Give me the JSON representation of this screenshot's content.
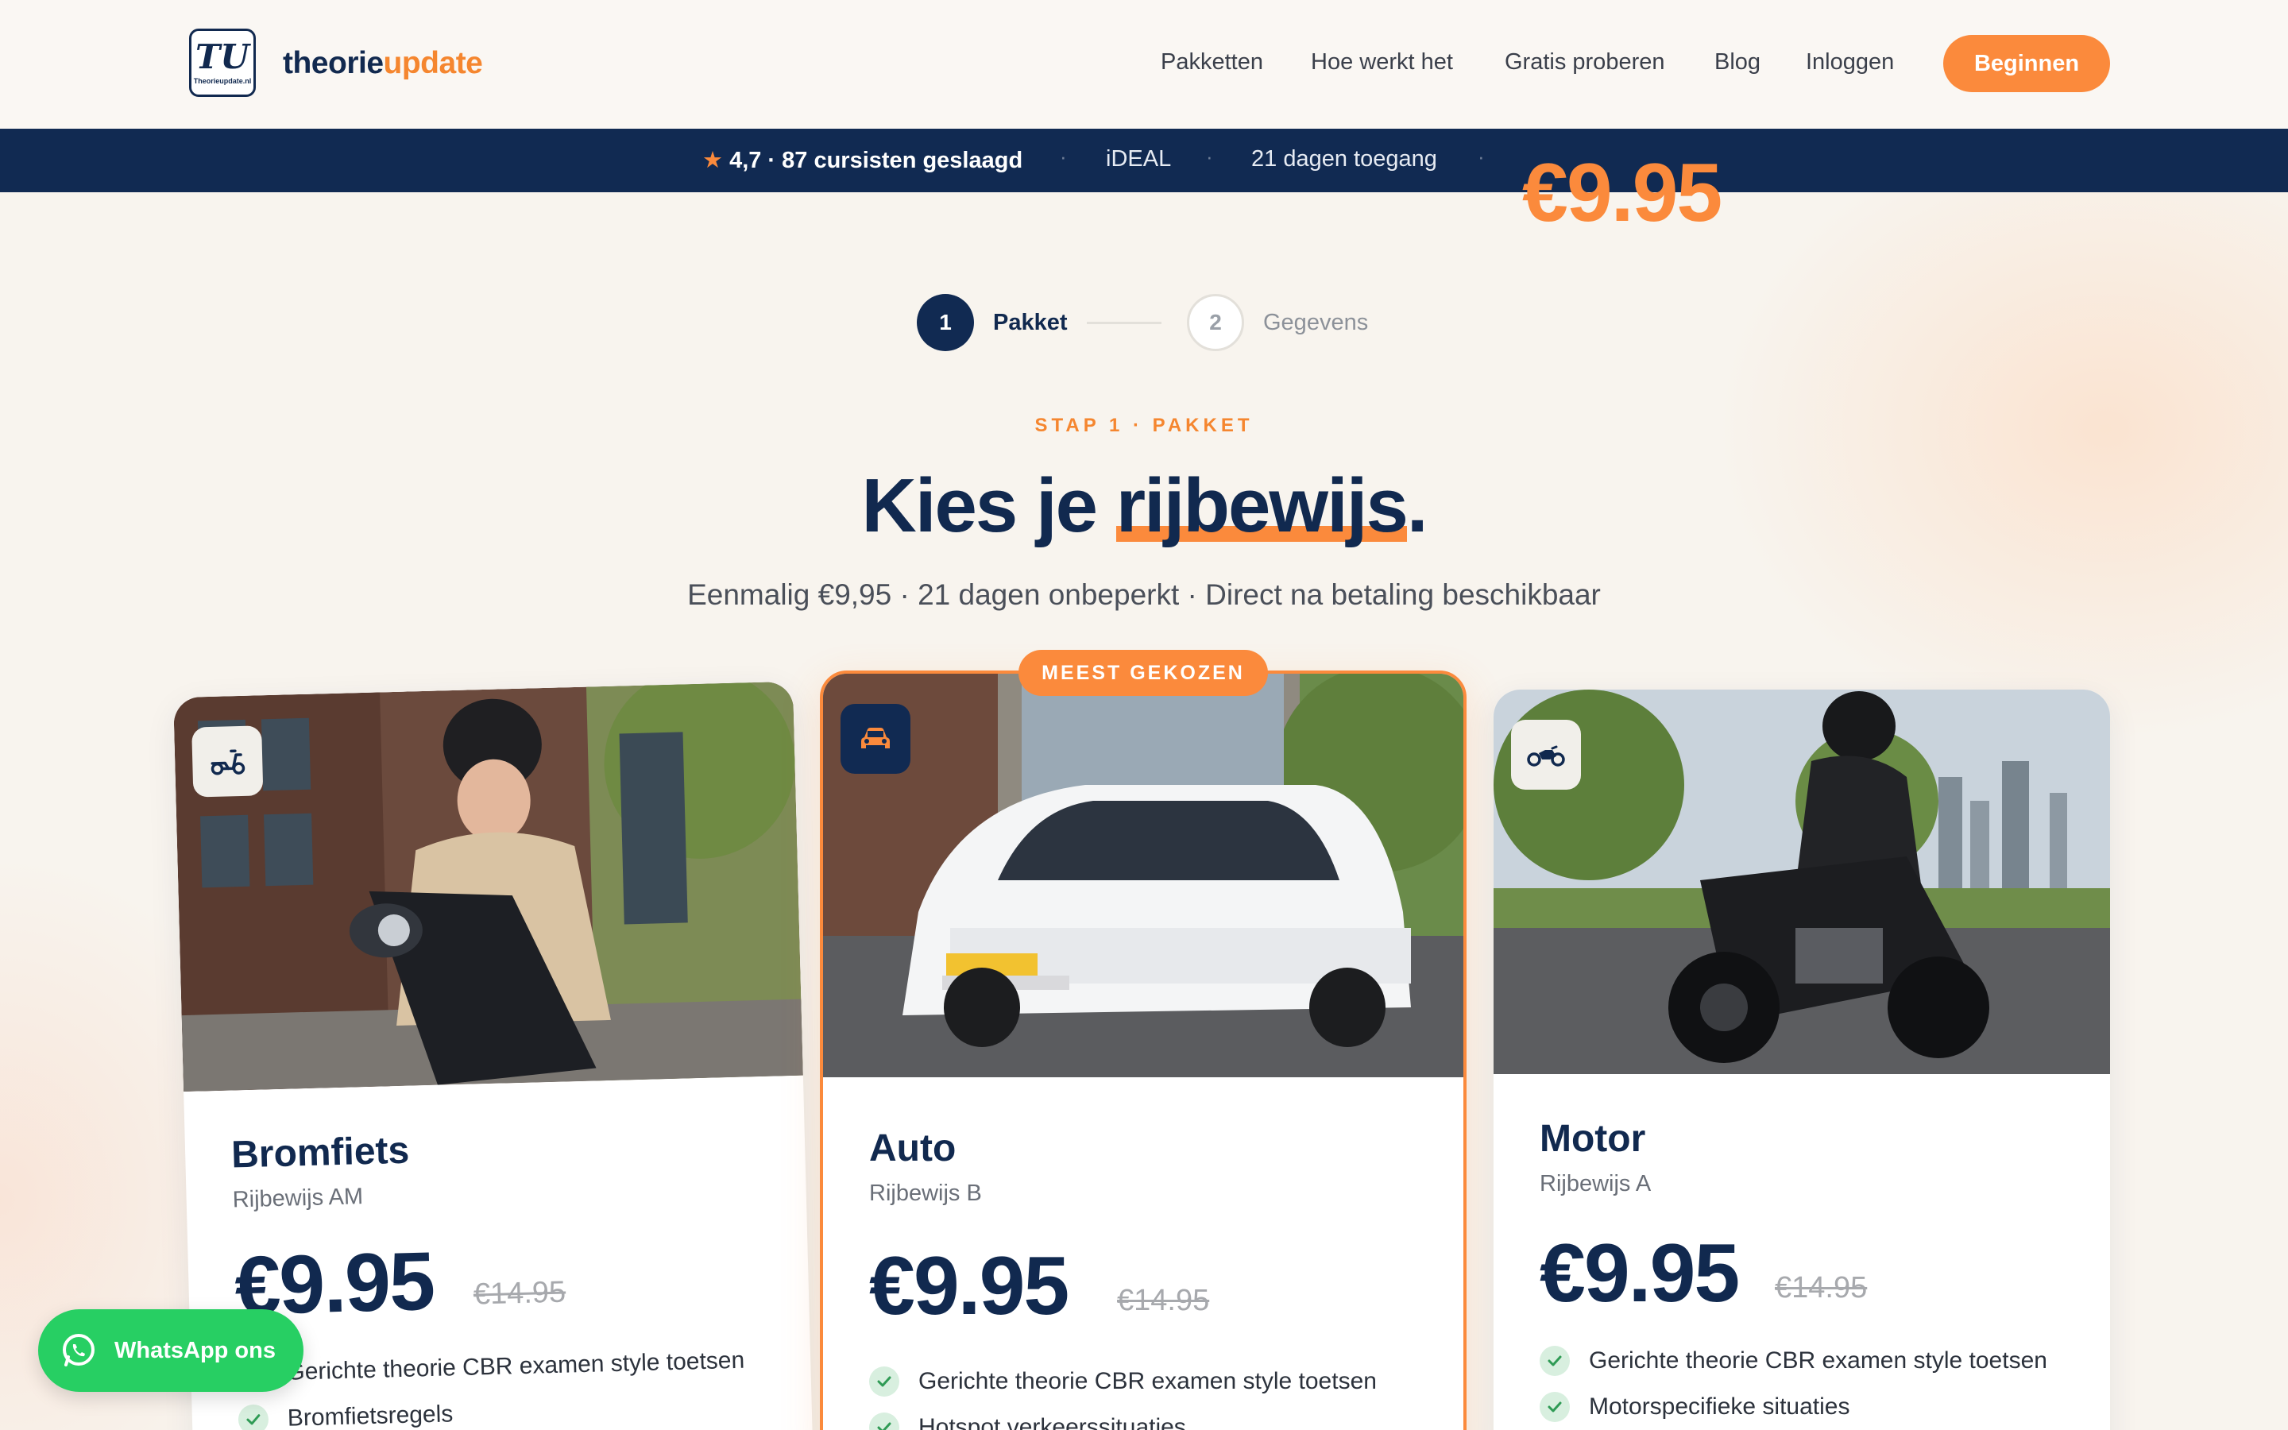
{
  "header": {
    "logo_mark": "TU",
    "logo_small": "Theorieupdate.nl",
    "brand_part1": "theorie",
    "brand_part2": "update",
    "nav": [
      "Pakketten",
      "Hoe werkt het",
      "Gratis proberen",
      "Blog",
      "Inloggen"
    ],
    "cta": "Beginnen"
  },
  "trustbar": {
    "rating": "4,7 · 87 cursisten geslaagd",
    "payment": "iDEAL",
    "access": "21 dagen toegang",
    "price": "€9.95",
    "separator": "·"
  },
  "stepper": {
    "steps": [
      {
        "number": "1",
        "label": "Pakket"
      },
      {
        "number": "2",
        "label": "Gegevens"
      }
    ]
  },
  "hero": {
    "eyebrow": "STAP 1 · PAKKET",
    "title_part1": "Kies je ",
    "title_highlight": "rijbewijs",
    "title_end": ".",
    "subtitle": "Eenmalig €9,95 · 21 dagen onbeperkt · Direct na betaling beschikbaar"
  },
  "cards": [
    {
      "icon": "scooter-icon",
      "title": "Bromfiets",
      "subtitle": "Rijbewijs AM",
      "price": "€9.95",
      "old_price": "€14.95",
      "features": [
        "Gerichte theorie CBR examen style toetsen",
        "Bromfietsregels"
      ]
    },
    {
      "icon": "car-icon",
      "badge": "MEEST GEKOZEN",
      "title": "Auto",
      "subtitle": "Rijbewijs B",
      "price": "€9.95",
      "old_price": "€14.95",
      "features": [
        "Gerichte theorie CBR examen style toetsen",
        "Hotspot verkeerssituaties"
      ]
    },
    {
      "icon": "motorcycle-icon",
      "title": "Motor",
      "subtitle": "Rijbewijs A",
      "price": "€9.95",
      "old_price": "€14.95",
      "features": [
        "Gerichte theorie CBR examen style toetsen",
        "Motorspecifieke situaties"
      ]
    }
  ],
  "whatsapp": {
    "label": "WhatsApp ons"
  },
  "colors": {
    "navy": "#112a52",
    "orange": "#fb8a3c",
    "whatsapp": "#27cf63",
    "background": "#f8f4ee"
  }
}
